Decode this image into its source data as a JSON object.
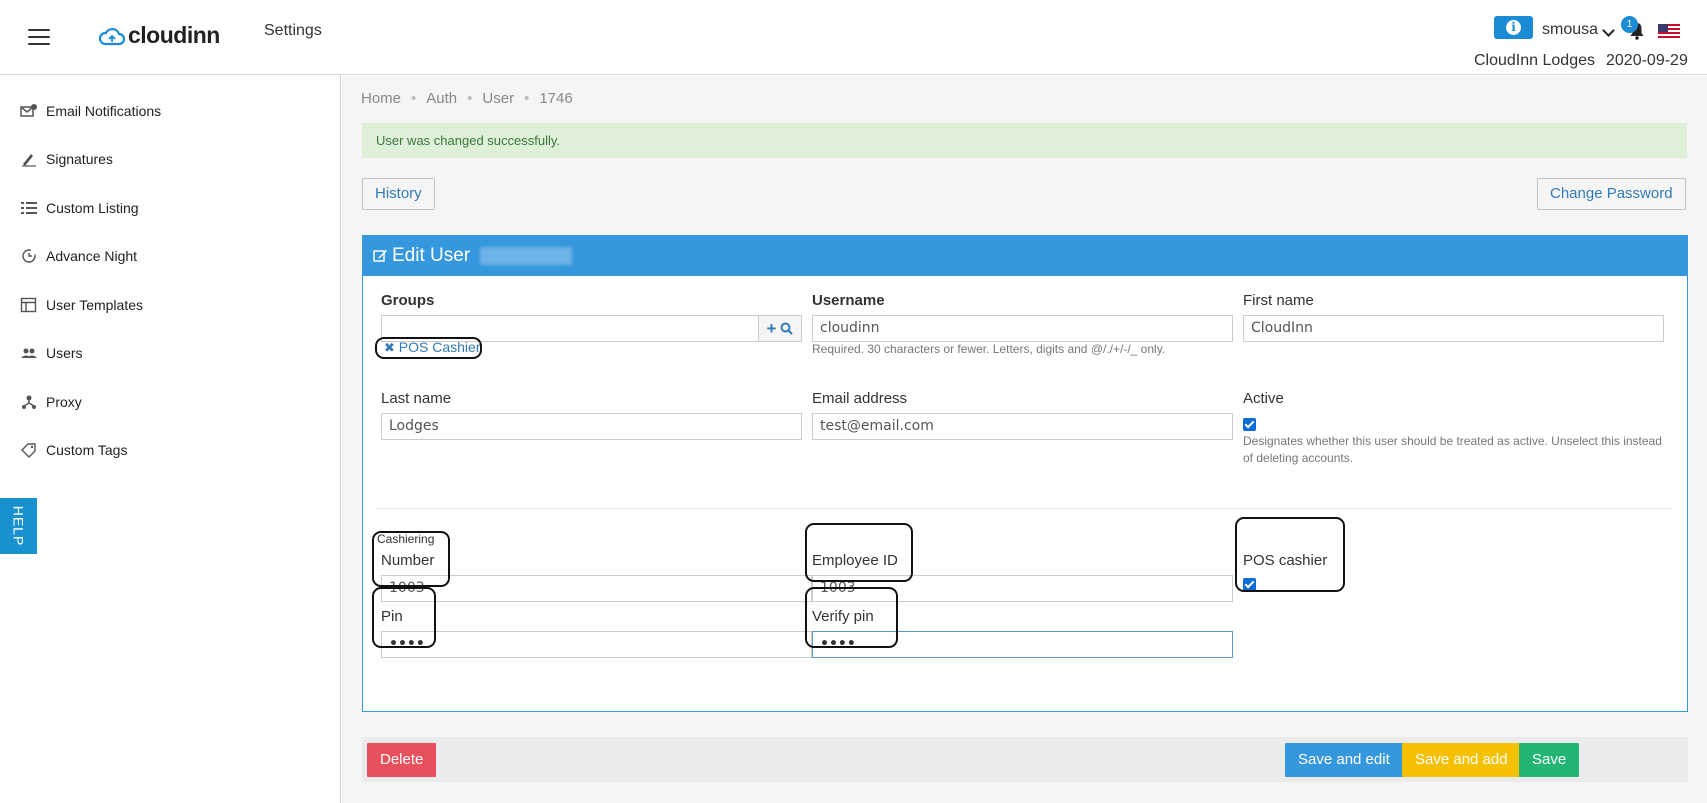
{
  "header": {
    "logo_text": "cloudinn",
    "section_title": "Settings",
    "info_icon_glyph": "i",
    "user_name": "smousa",
    "notification_count": "1",
    "property_name": "CloudInn Lodges",
    "date": "2020-09-29"
  },
  "sidebar": {
    "items": [
      {
        "label": "Email Notifications",
        "icon": "email-settings-icon"
      },
      {
        "label": "Signatures",
        "icon": "pen-icon"
      },
      {
        "label": "Custom Listing",
        "icon": "list-icon"
      },
      {
        "label": "Advance Night",
        "icon": "clock-icon"
      },
      {
        "label": "User Templates",
        "icon": "template-icon"
      },
      {
        "label": "Users",
        "icon": "users-icon"
      },
      {
        "label": "Proxy",
        "icon": "network-icon"
      },
      {
        "label": "Custom Tags",
        "icon": "tag-icon"
      }
    ],
    "help_label": "HELP"
  },
  "breadcrumb": [
    "Home",
    "Auth",
    "User",
    "1746"
  ],
  "alert": "User was changed successfully.",
  "buttons": {
    "history": "History",
    "change_password": "Change Password",
    "delete": "Delete",
    "save_and_edit": "Save and edit",
    "save_and_add": "Save and add",
    "save": "Save"
  },
  "form": {
    "title": "Edit User",
    "groups_label": "Groups",
    "groups_input": "",
    "group_chip": "POS Cashier",
    "username_label": "Username",
    "username_value": "cloudinn",
    "username_help": "Required. 30 characters or fewer. Letters, digits and @/./+/-/_ only.",
    "first_name_label": "First name",
    "first_name_value": "CloudInn",
    "last_name_label": "Last name",
    "last_name_value": "Lodges",
    "email_label": "Email address",
    "email_value": "test@email.com",
    "active_label": "Active",
    "active_checked": true,
    "active_help": "Designates whether this user should be treated as active. Unselect this instead of deleting accounts.",
    "cashiering_label": "Cashiering",
    "number_label": "Number",
    "number_value": "1003",
    "employee_id_label": "Employee ID",
    "employee_id_value": "1003",
    "pos_cashier_label": "POS cashier",
    "pos_cashier_checked": true,
    "pin_label": "Pin",
    "pin_value": "••••",
    "verify_pin_label": "Verify pin",
    "verify_pin_value": "••••"
  },
  "colors": {
    "primary": "#3597dd",
    "alert_bg": "#dff0d8",
    "delete": "#e8505b",
    "save_add": "#f5c000",
    "save": "#22b573"
  }
}
